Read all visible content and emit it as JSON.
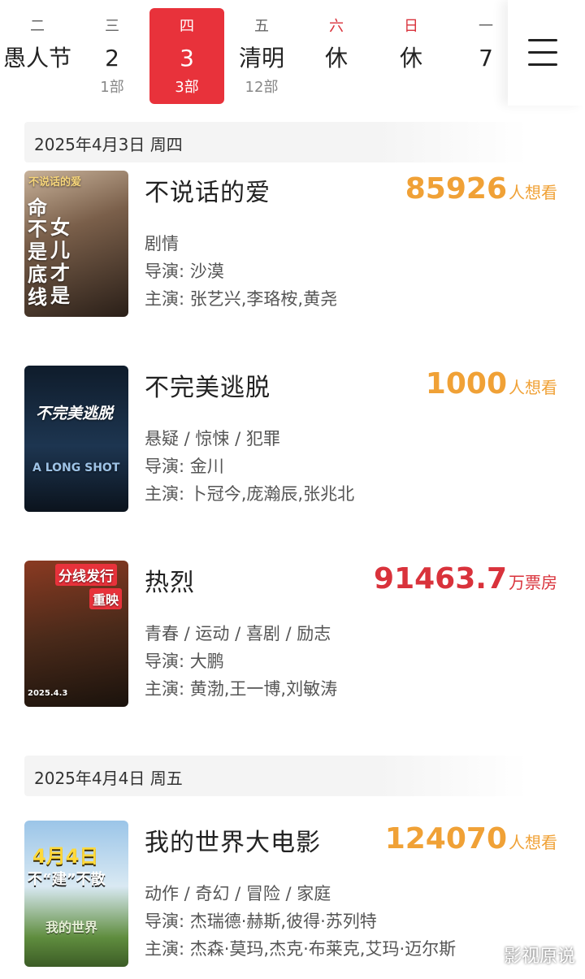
{
  "days": [
    {
      "weekday": "二",
      "date": "愚人节",
      "count": "",
      "active": false,
      "weekend": false
    },
    {
      "weekday": "三",
      "date": "2",
      "count": "1部",
      "active": false,
      "weekend": false
    },
    {
      "weekday": "四",
      "date": "3",
      "count": "3部",
      "active": true,
      "weekend": false
    },
    {
      "weekday": "五",
      "date": "清明",
      "count": "12部",
      "active": false,
      "weekend": false
    },
    {
      "weekday": "六",
      "date": "休",
      "count": "",
      "active": false,
      "weekend": true
    },
    {
      "weekday": "日",
      "date": "休",
      "count": "",
      "active": false,
      "weekend": true
    },
    {
      "weekday": "一",
      "date": "7",
      "count": "",
      "active": false,
      "weekend": false
    }
  ],
  "menu_icon": "hamburger-menu-icon",
  "sections": [
    {
      "date_label": "2025年4月3日  周四",
      "movies": [
        {
          "title": "不说话的爱",
          "metric_value": "85926",
          "metric_unit": "人想看",
          "genres": "剧情",
          "director": "导演: 沙漠",
          "cast": "主演: 张艺兴,李珞桉,黄尧",
          "poster_text": [
            "不说话的爱",
            "命",
            "不是底线",
            "女儿才是"
          ]
        },
        {
          "title": "不完美逃脱",
          "metric_value": "1000",
          "metric_unit": "人想看",
          "genres": "悬疑 / 惊悚 / 犯罪",
          "director": "导演: 金川",
          "cast": "主演: 卜冠今,庞瀚辰,张兆北",
          "poster_text": [
            "不完美逃脱",
            "A LONG SHOT"
          ]
        },
        {
          "title": "热烈",
          "metric_value": "91463.7",
          "metric_unit": "万票房",
          "genres": "青春 / 运动 / 喜剧 / 励志",
          "director": "导演: 大鹏",
          "cast": "主演: 黄渤,王一博,刘敏涛",
          "poster_text": [
            "分线发行",
            "重映",
            "2025.4.3"
          ]
        }
      ]
    },
    {
      "date_label": "2025年4月4日  周五",
      "movies": [
        {
          "title": "我的世界大电影",
          "metric_value": "124070",
          "metric_unit": "人想看",
          "genres": "动作 / 奇幻 / 冒险 / 家庭",
          "director": "导演: 杰瑞德·赫斯,彼得·苏列特",
          "cast": "主演: 杰森·莫玛,杰克·布莱克,艾玛·迈尔斯",
          "poster_text": [
            "4月4日",
            "不“建”不散",
            "我的世界"
          ]
        }
      ]
    }
  ],
  "watermark": "影视原说",
  "colors": {
    "accent_red": "#e8323b",
    "want_orange": "#f0a136",
    "boxoffice_red": "#d9323b"
  }
}
